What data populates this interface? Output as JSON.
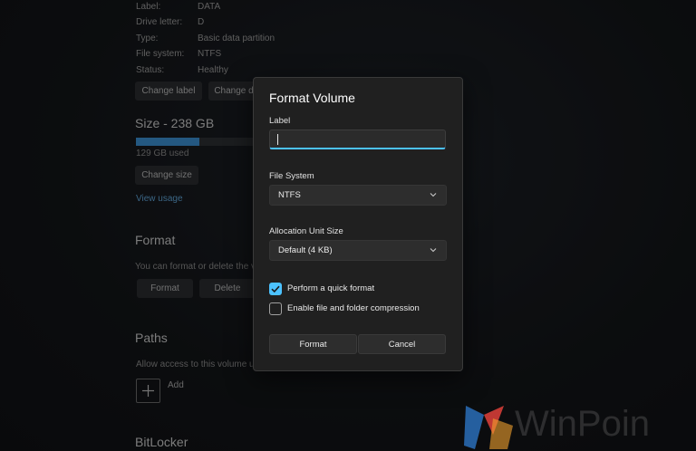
{
  "properties": [
    {
      "key": "Label:",
      "value": "DATA"
    },
    {
      "key": "Drive letter:",
      "value": "D"
    },
    {
      "key": "Type:",
      "value": "Basic data partition"
    },
    {
      "key": "File system:",
      "value": "NTFS"
    },
    {
      "key": "Status:",
      "value": "Healthy"
    }
  ],
  "buttons": {
    "change_label": "Change label",
    "change_drive": "Change d"
  },
  "size": {
    "title": "Size - 238 GB",
    "used_fraction": 0.54,
    "used_label": "129 GB used",
    "change_size": "Change size",
    "view_usage": "View usage"
  },
  "format_section": {
    "title": "Format",
    "description": "You can format or delete the v",
    "format_button": "Format",
    "delete_button": "Delete"
  },
  "paths_section": {
    "title": "Paths",
    "description": "Allow access to this volume us",
    "add_label": "Add"
  },
  "bitlocker_section": {
    "title": "BitLocker"
  },
  "dialog": {
    "title": "Format Volume",
    "label_field": {
      "label": "Label",
      "value": "",
      "placeholder": ""
    },
    "file_system": {
      "label": "File System",
      "selected": "NTFS"
    },
    "allocation": {
      "label": "Allocation Unit Size",
      "selected": "Default (4 KB)"
    },
    "quick_format": {
      "label": "Perform a quick format",
      "checked": true
    },
    "compression": {
      "label": "Enable file and folder compression",
      "checked": false
    },
    "ok_button": "Format",
    "cancel_button": "Cancel"
  },
  "watermark": {
    "text": "WinPoin"
  },
  "colors": {
    "accent": "#4cc2ff",
    "usage_bar": "#3b8ed0",
    "dialog_bg": "#202020"
  }
}
